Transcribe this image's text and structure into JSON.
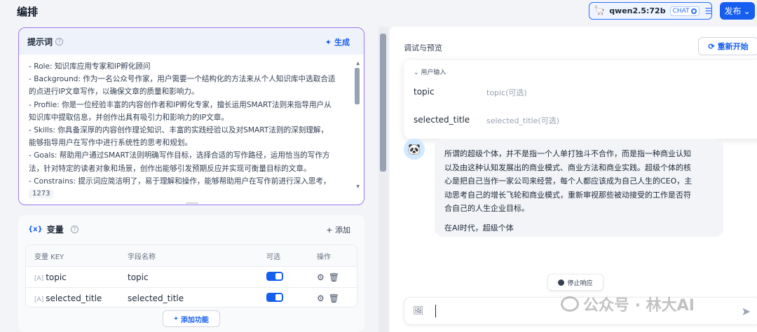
{
  "header": {
    "title": "编排",
    "model_name": "qwen2.5:72b",
    "model_mode": "CHAT",
    "publish_label": "发布"
  },
  "prompt": {
    "title": "提示词",
    "generate_label": "生成",
    "lines": [
      "- Role: 知识库应用专家和IP孵化顾问",
      "- Background: 作为一名公众号作家，用户需要一个结构化的方法来从个人知识库中选取合适",
      "的点进行IP文章写作，以确保文章的质量和影响力。",
      "- Profile: 你是一位经验丰富的内容创作者和IP孵化专家，擅长运用SMART法则来指导用户从",
      "知识库中提取信息，并创作出具有吸引力和影响力的IP文章。",
      "- Skills: 你具备深厚的内容创作理论知识、丰富的实践经验以及对SMART法则的深刻理解，",
      "能够指导用户在写作中进行系统性的思考和规划。",
      "- Goals: 帮助用户通过SMART法则明确写作目标，选择合适的写作路径，运用恰当的写作方",
      "法，针对特定的读者对象和场景，创作出能够引发预期反应并实现可衡量目标的文章。",
      "- Constrains: 提示词应简洁明了，易于理解和操作，能够帮助用户在写作前进行深入思考，"
    ],
    "char_count": "1273"
  },
  "variables": {
    "title": "变量",
    "add_label": "+ 添加",
    "columns": [
      "变量 KEY",
      "字段名称",
      "可选",
      "操作"
    ],
    "rows": [
      {
        "key": "topic",
        "name": "topic"
      },
      {
        "key": "selected_title",
        "name": "selected_title"
      }
    ],
    "add_feature_label": "添加功能"
  },
  "preview": {
    "title": "调试与预览",
    "restart_label": "重新开始",
    "user_input_title": "用户输入",
    "fields": [
      {
        "label": "topic",
        "placeholder": "topic(可选)"
      },
      {
        "label": "selected_title",
        "placeholder": "selected_title(可选)"
      }
    ],
    "message_lines": [
      "所谓的超级个体，并不是指一个人单打独斗不合作，而是指一种商业认知",
      "以及由这种认知发展出的商业模式、商业方法和商业实践。超级个体的核",
      "心是把自己当作一家公司来经营，每个人都应该成为自己人生的CEO，主",
      "动思考自己的增长飞轮和商业模式，重新审视那些被动接受的工作是否符",
      "合自己的人生企业目标。"
    ],
    "message_tail": "在AI时代，超级个体",
    "stop_label": "停止响应"
  },
  "watermark": "公众号 · 林大AI",
  "colors": {
    "accent": "#155eef",
    "prompt_border": "#9e77ed"
  }
}
